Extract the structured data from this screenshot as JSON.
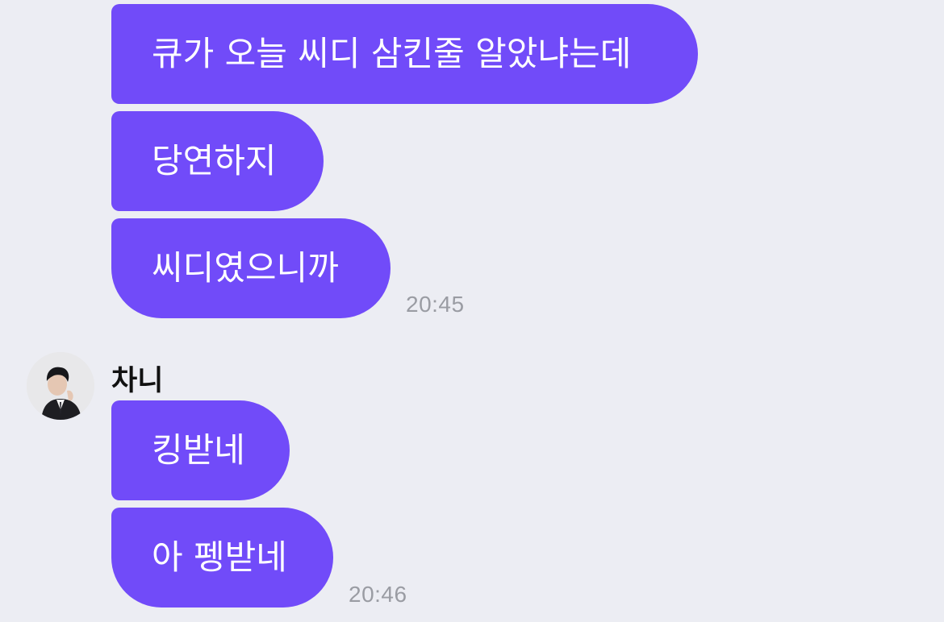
{
  "messages_group_1": [
    {
      "text": "큐가 오늘 씨디 삼킨줄 알았냐는데"
    },
    {
      "text": "당연하지"
    },
    {
      "text": "씨디였으니까"
    }
  ],
  "timestamp_1": "20:45",
  "sender": {
    "name": "차니",
    "avatar_icon": "profile-photo"
  },
  "messages_group_2": [
    {
      "text": "킹받네"
    },
    {
      "text": "아 펭받네"
    }
  ],
  "timestamp_2": "20:46",
  "colors": {
    "background": "#ECEDF3",
    "bubble": "#714BF9",
    "bubble_text": "#FFFFFF",
    "timestamp": "#9A9CA3"
  }
}
